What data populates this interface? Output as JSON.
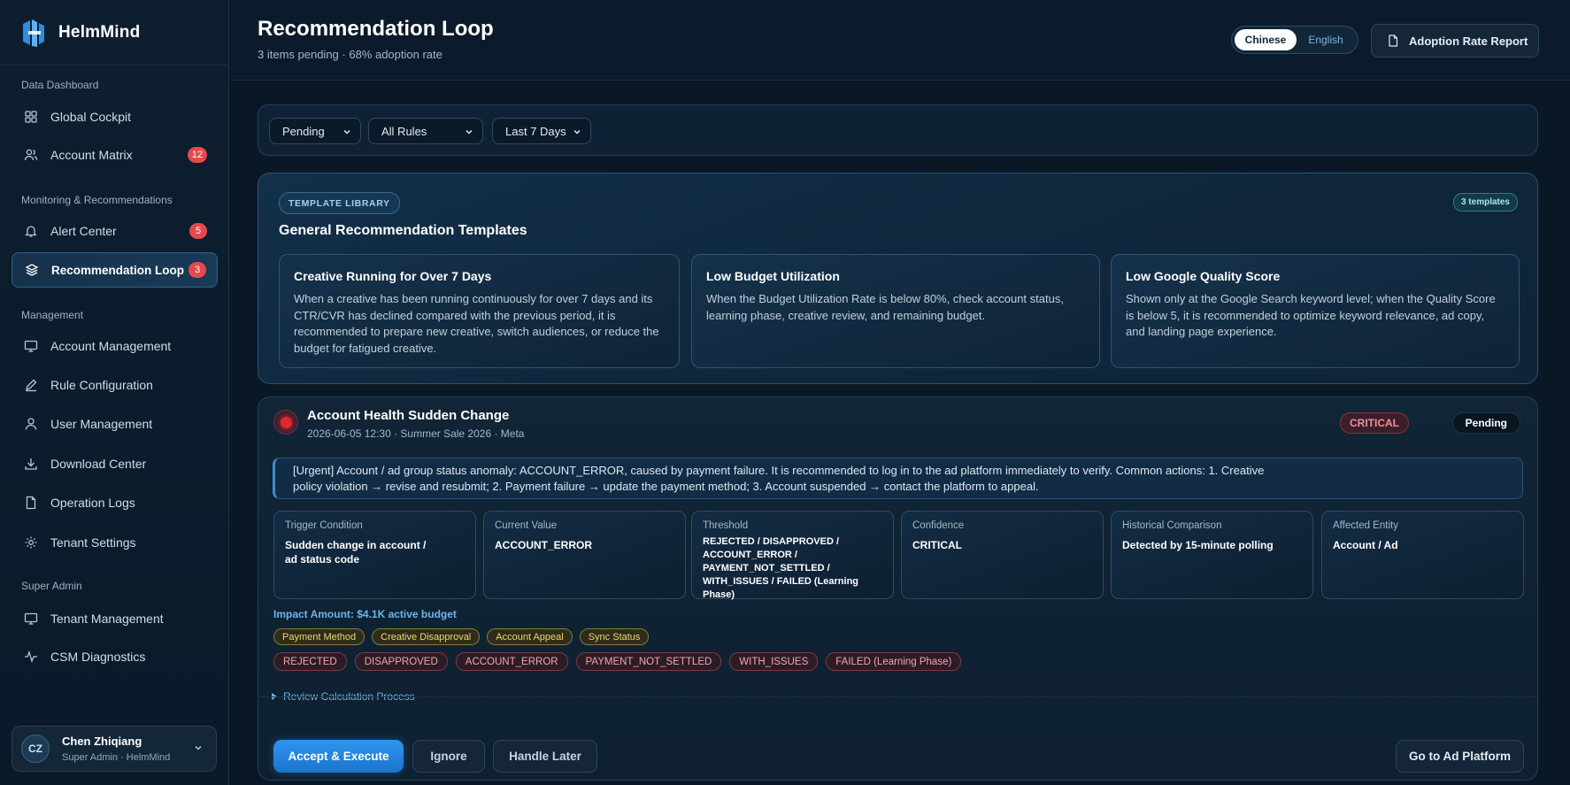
{
  "brand": {
    "name": "HelmMind"
  },
  "sidebar": {
    "sections": [
      {
        "label": "Data Dashboard"
      },
      {
        "label": "Monitoring & Recommendations"
      },
      {
        "label": "Management"
      },
      {
        "label": "Super Admin"
      }
    ],
    "items": [
      {
        "label": "Global Cockpit",
        "icon": "grid-icon"
      },
      {
        "label": "Account Matrix",
        "icon": "users-icon",
        "badge": "12"
      },
      {
        "label": "Alert Center",
        "icon": "bell-icon",
        "badge": "5"
      },
      {
        "label": "Recommendation Loop",
        "icon": "layers-icon",
        "badge": "3",
        "active": true
      },
      {
        "label": "Account Management",
        "icon": "monitor-icon"
      },
      {
        "label": "Rule Configuration",
        "icon": "pencil-icon"
      },
      {
        "label": "User Management",
        "icon": "user-icon"
      },
      {
        "label": "Download Center",
        "icon": "download-icon"
      },
      {
        "label": "Operation Logs",
        "icon": "file-icon"
      },
      {
        "label": "Tenant Settings",
        "icon": "gear-icon"
      },
      {
        "label": "Tenant Management",
        "icon": "monitor-icon"
      },
      {
        "label": "CSM Diagnostics",
        "icon": "pulse-icon"
      }
    ]
  },
  "user": {
    "initials": "CZ",
    "name": "Chen Zhiqiang",
    "role": "Super Admin · HelmMind"
  },
  "header": {
    "title": "Recommendation Loop",
    "subtitle": "3 items pending · 68% adoption rate",
    "lang": {
      "active": "Chinese",
      "inactive": "English"
    },
    "report_button": "Adoption Rate Report"
  },
  "filters": {
    "status": "Pending",
    "rules": "All Rules",
    "range": "Last 7 Days"
  },
  "template_library": {
    "tag": "TEMPLATE LIBRARY",
    "count": "3 templates",
    "title": "General Recommendation Templates",
    "cards": [
      {
        "title": "Creative Running for Over 7 Days",
        "body": "When a creative has been running continuously for over 7 days and its CTR/CVR has declined compared with the previous period, it is recommended to prepare new creative, switch audiences, or reduce the budget for fatigued creative."
      },
      {
        "title": "Low Budget Utilization",
        "body": "When the Budget Utilization Rate is below 80%, check account status, learning phase, creative review, and remaining budget."
      },
      {
        "title": "Low Google Quality Score",
        "body": "Shown only at the Google Search keyword level; when the Quality Score is below 5, it is recommended to optimize keyword relevance, ad copy, and landing page experience."
      }
    ]
  },
  "alert": {
    "title": "Account Health Sudden Change",
    "meta": "2026-06-05 12:30 · Summer Sale 2026 · Meta",
    "severity": "CRITICAL",
    "status": "Pending",
    "message_line1": "[Urgent] Account / ad group status anomaly: ACCOUNT_ERROR, caused by payment failure. It is recommended to log in to the ad platform immediately to verify. Common actions: 1. Creative",
    "message_line2": "policy violation → revise and resubmit; 2. Payment failure → update the payment method; 3. Account suspended → contact the platform to appeal.",
    "metrics": [
      {
        "label": "Trigger Condition",
        "lines": [
          "Sudden change in account /",
          "ad status code"
        ]
      },
      {
        "label": "Current Value",
        "lines": [
          "ACCOUNT_ERROR"
        ]
      },
      {
        "label": "Threshold",
        "lines": [
          "REJECTED / DISAPPROVED /",
          "ACCOUNT_ERROR /",
          "PAYMENT_NOT_SETTLED /",
          "WITH_ISSUES / FAILED (Learning Phase)"
        ]
      },
      {
        "label": "Confidence",
        "lines": [
          "CRITICAL"
        ]
      },
      {
        "label": "Historical Comparison",
        "lines": [
          "Detected by 15-minute polling"
        ]
      },
      {
        "label": "Affected Entity",
        "lines": [
          "Account / Ad"
        ]
      }
    ],
    "impact": "Impact Amount: $4.1K active budget",
    "action_tags": [
      "Payment Method",
      "Creative Disapproval",
      "Account Appeal",
      "Sync Status"
    ],
    "status_tags": [
      "REJECTED",
      "DISAPPROVED",
      "ACCOUNT_ERROR",
      "PAYMENT_NOT_SETTLED",
      "WITH_ISSUES",
      "FAILED (Learning Phase)"
    ],
    "review_link": "Review Calculation Process",
    "buttons": {
      "accept": "Accept & Execute",
      "ignore": "Ignore",
      "later": "Handle Later",
      "platform": "Go to Ad Platform"
    }
  },
  "colors": {
    "accent": "#2e95ee",
    "badge": "#e5484d",
    "critical": "#e5242f",
    "background": "#0a1826"
  }
}
